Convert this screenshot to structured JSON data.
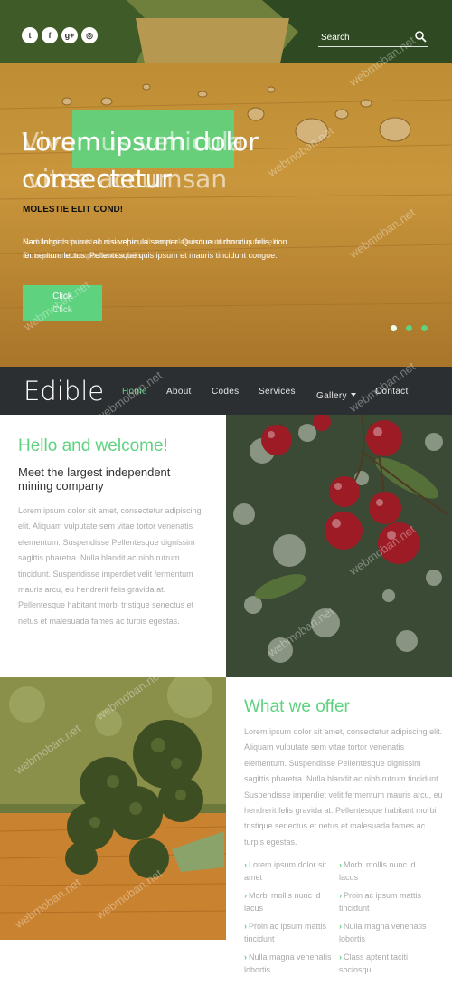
{
  "hero": {
    "social": [
      "t",
      "f",
      "g+",
      "◎"
    ],
    "search_placeholder": "Search",
    "title_line1": "Lorem ipsum dolor",
    "title_line1_overlay": "Vivamus vehicula",
    "title_line2": "consectetur",
    "title_line2_overlay": "vitae accumsan",
    "subtitle": "MOLESTIE ELIT COND!",
    "text": "Nam lobortis purus ac nisi vehicula semper. Quisque ut rhoncus felis, non fermentum lectus. Pellentesque quis ipsum et mauris tincidunt congue.",
    "text_overlay": "Sed feugiat nisi et tellus semper, sit amet elementum tortor aliquam elit. Duis placerat tempus auctor felis.",
    "button_label": "Click",
    "button_label_overlay": "Click",
    "slides": 3,
    "active_slide": 1,
    "accent": "#5ed27f"
  },
  "nav": {
    "logo": "Edible",
    "items": [
      "Home",
      "About",
      "Codes",
      "Services",
      "Gallery",
      "Contact"
    ],
    "active": "Home"
  },
  "welcome": {
    "title": "Hello and welcome!",
    "subtitle": "Meet the largest independent mining company",
    "body": "Lorem ipsum dolor sit amet, consectetur adipiscing elit. Aliquam vulputate sem vitae tortor venenatis elementum. Suspendisse Pellentesque dignissim sagittis pharetra. Nulla blandit ac nibh rutrum tincidunt. Suspendisse imperdiet velit fermentum mauris arcu, eu hendrerit felis gravida at. Pellentesque habitant morbi tristique senectus et netus et malesuada fames ac turpis egestas."
  },
  "offer": {
    "title": "What we offer",
    "body": "Lorem ipsum dolor sit amet, consectetur adipiscing elit. Aliquam vulputate sem vitae tortor venenatis elementum. Suspendisse Pellentesque dignissim sagittis pharetra. Nulla blandit ac nibh rutrum tincidunt. Suspendisse imperdiet velit fermentum mauris arcu, eu hendrerit felis gravida at. Pellentesque habitant morbi tristique senectus et netus et malesuada fames ac turpis egestas.",
    "items": [
      "Lorem ipsum dolor sit amet",
      "Morbi mollis nunc id lacus",
      "Morbi mollis nunc id lacus",
      "Proin ac ipsum mattis tincidunt",
      "Proin ac ipsum mattis tincidunt",
      "Nulla magna venenatis lobortis",
      "Nulla magna venenatis lobortis",
      "Class aptent taciti sociosqu"
    ]
  },
  "watermark": "webmoban.net"
}
